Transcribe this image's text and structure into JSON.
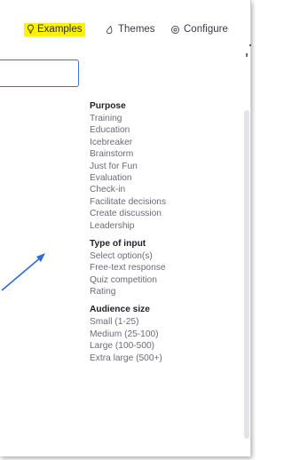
{
  "tabs": {
    "examples": "Examples",
    "themes": "Themes",
    "configure": "Configure"
  },
  "search": {
    "placeholder": ""
  },
  "sections": {
    "purpose": {
      "title": "Purpose",
      "items": [
        "Training",
        "Education",
        "Icebreaker",
        "Brainstorm",
        "Just for Fun",
        "Evaluation",
        "Check-in",
        "Facilitate decisions",
        "Create discussion",
        "Leadership"
      ]
    },
    "type_of_input": {
      "title": "Type of input",
      "items": [
        "Select option(s)",
        "Free-text response",
        "Quiz competition",
        "Rating"
      ]
    },
    "audience_size": {
      "title": "Audience size",
      "items": [
        "Small (1-25)",
        "Medium (25-100)",
        "Large (100-500)",
        "Extra large (500+)"
      ]
    }
  },
  "colors": {
    "highlight": "#fff200",
    "search_border": "#3a6fe0",
    "arrow": "#2f6bd6"
  },
  "icons": {
    "examples": "lightbulb-icon",
    "themes": "paint-drop-icon",
    "configure": "gear-icon"
  }
}
